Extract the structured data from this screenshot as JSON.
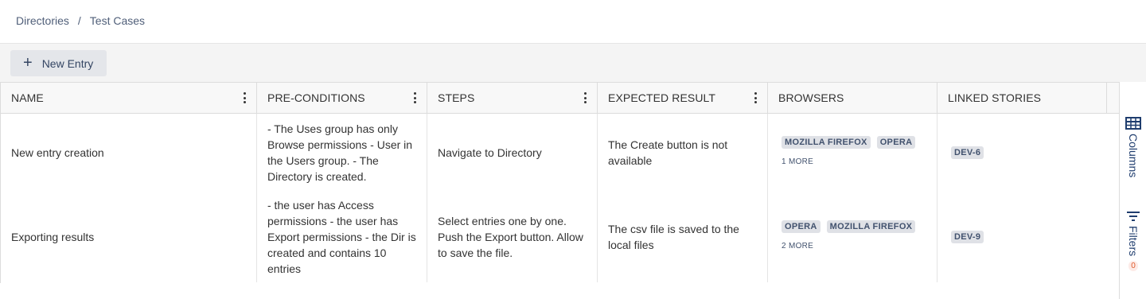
{
  "breadcrumb": {
    "items": [
      "Directories",
      "Test Cases"
    ],
    "separator": "/"
  },
  "toolbar": {
    "new_entry_label": "New Entry"
  },
  "table": {
    "columns": [
      "NAME",
      "PRE-CONDITIONS",
      "STEPS",
      "EXPECTED RESULT",
      "BROWSERS",
      "LINKED STORIES"
    ],
    "rows": [
      {
        "name": "New entry creation",
        "preconditions": "- The Uses group has only Browse permissions - User in the Users group. - The Directory is created.",
        "steps": "Navigate to Directory",
        "expected": "The Create button is not available",
        "browsers": [
          "MOZILLA FIREFOX",
          "OPERA"
        ],
        "more": "1 MORE",
        "story": "DEV-6"
      },
      {
        "name": "Exporting results",
        "preconditions": "- the user has Access permissions - the user has Export permissions - the Dir is created and contains 10 entries",
        "steps": "Select entries one by one. Push the Export button. Allow to save the file.",
        "expected": "The csv file is saved to the local files",
        "browsers": [
          "OPERA",
          "MOZILLA FIREFOX"
        ],
        "more": "2 MORE",
        "story": "DEV-9"
      }
    ]
  },
  "sidepanel": {
    "columns_label": "Columns",
    "filters_label": "Filters",
    "filters_count": "0",
    "columns_icon": "table-grid-icon",
    "filters_icon": "filter-icon"
  }
}
